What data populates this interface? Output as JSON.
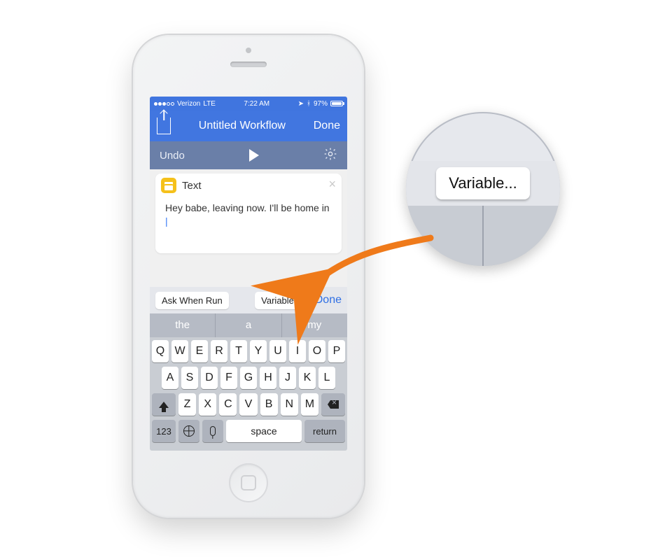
{
  "statusbar": {
    "carrier": "Verizon",
    "net": "LTE",
    "time": "7:22 AM",
    "battery_pct": "97%",
    "signal_filled": 3,
    "signal_total": 5
  },
  "nav": {
    "title": "Untitled Workflow",
    "done": "Done"
  },
  "toolbar": {
    "undo": "Undo"
  },
  "card": {
    "title": "Text",
    "body": "Hey babe, leaving now. I'll be home in "
  },
  "accessory": {
    "ask": "Ask When Run",
    "variable": "Variable...",
    "done": "Done"
  },
  "predict": [
    "the",
    "a",
    "my"
  ],
  "keyboard": {
    "r1": [
      "Q",
      "W",
      "E",
      "R",
      "T",
      "Y",
      "U",
      "I",
      "O",
      "P"
    ],
    "r2": [
      "A",
      "S",
      "D",
      "F",
      "G",
      "H",
      "J",
      "K",
      "L"
    ],
    "r3": [
      "Z",
      "X",
      "C",
      "V",
      "B",
      "N",
      "M"
    ],
    "num": "123",
    "space": "space",
    "ret": "return"
  },
  "magnifier": {
    "variable": "Variable..."
  }
}
